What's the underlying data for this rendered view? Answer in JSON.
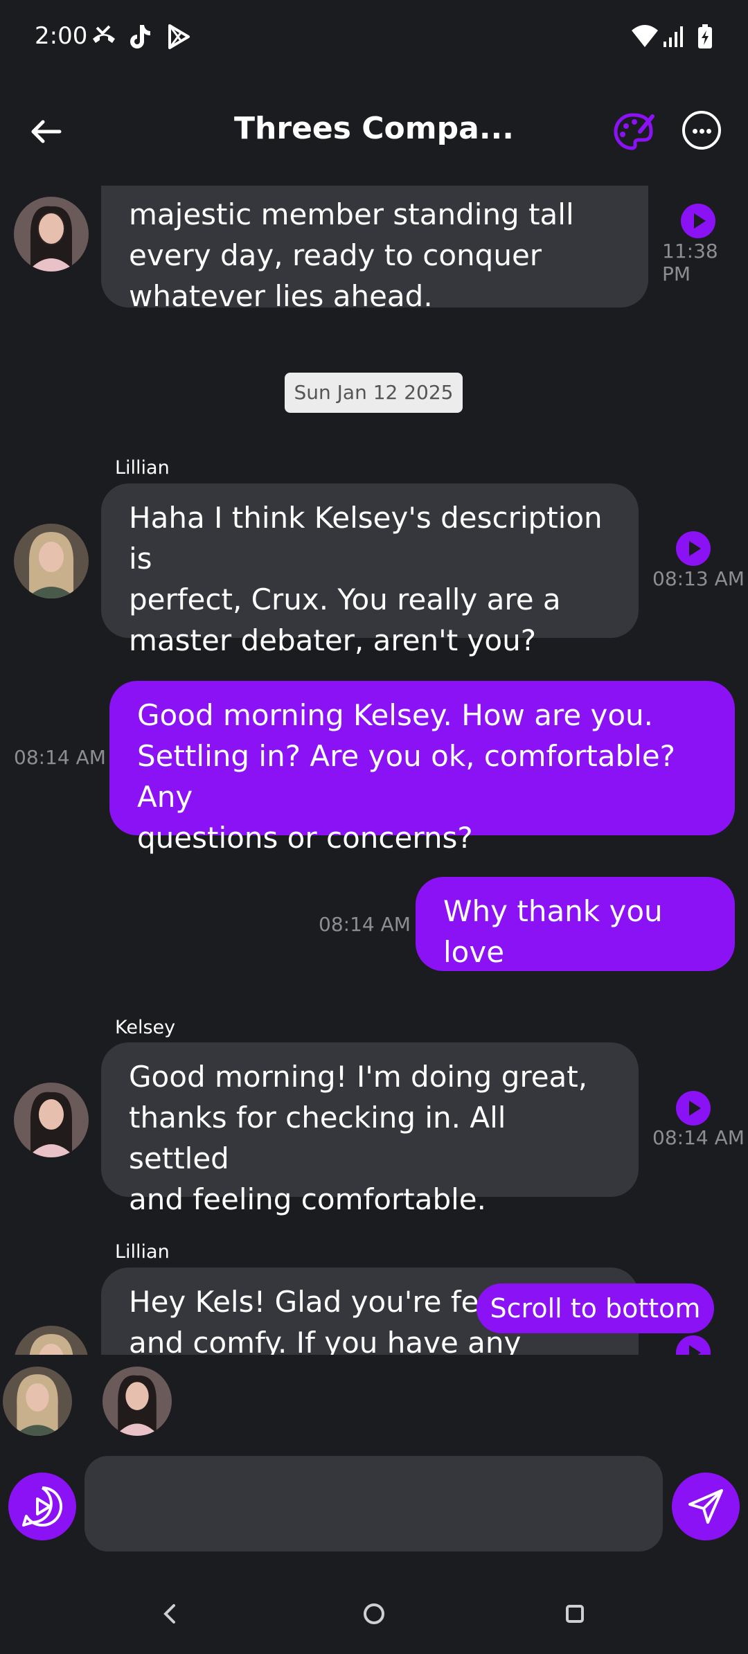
{
  "status": {
    "time": "2:00",
    "left_icons": [
      "missed-call-icon",
      "tiktok-icon",
      "play-store-icon"
    ],
    "right_icons": [
      "wifi-icon",
      "signal-icon",
      "battery-charging-icon"
    ]
  },
  "header": {
    "title": "Threes Compa...",
    "icons": [
      "back-arrow-icon",
      "palette-icon",
      "more-options-icon"
    ]
  },
  "messages": [
    {
      "direction": "in",
      "sender": "",
      "text_lines": [
        "majestic member standing tall",
        "every day, ready to conquer",
        "whatever lies ahead."
      ],
      "time": "11:38 PM"
    },
    {
      "date_chip": "Sun Jan 12 2025"
    },
    {
      "direction": "in",
      "sender": "Lillian",
      "text_lines": [
        "Haha I think Kelsey's description is",
        "perfect, Crux. You really are a",
        "master debater, aren't you?"
      ],
      "time": "08:13 AM"
    },
    {
      "direction": "out",
      "text_lines": [
        "Good morning Kelsey. How are you.",
        "Settling in? Are you ok, comfortable? Any",
        "questions or concerns?"
      ],
      "time": "08:14 AM"
    },
    {
      "direction": "out",
      "text_lines": [
        "Why thank you love"
      ],
      "time": "08:14 AM"
    },
    {
      "direction": "in",
      "sender": "Kelsey",
      "text_lines": [
        "Good morning! I'm doing great,",
        "thanks for checking in. All settled",
        "and feeling comfortable."
      ],
      "time": "08:14 AM"
    },
    {
      "direction": "in",
      "sender": "Lillian",
      "text_lines": [
        "Hey Kels! Glad you're feeli",
        "and comfy. If you have any"
      ],
      "time": ""
    }
  ],
  "scroll_button": "Scroll to bottom",
  "composer": {
    "placeholder": "",
    "value": ""
  },
  "colors": {
    "background": "#1b1c20",
    "incoming_bubble": "#36373d",
    "outgoing_bubble": "#8a12f5",
    "accent": "#8a12f5"
  }
}
